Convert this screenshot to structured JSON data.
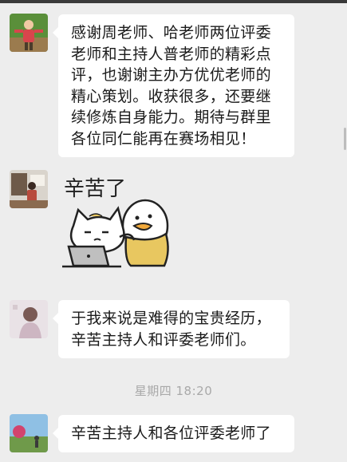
{
  "messages": [
    {
      "type": "text",
      "lines": [
        "感谢周老师、哈老师两位评委",
        "老师和主持人普老师的精彩点",
        "评，也谢谢主办方优优老师的",
        "精心策划。收获很多，还要继",
        "续修炼自身能力。期待与群里",
        "各位同仁能再在赛场相见！"
      ]
    },
    {
      "type": "sticker",
      "caption": "辛苦了"
    },
    {
      "type": "text",
      "lines": [
        "于我来说是难得的宝贵经历，",
        "辛苦主持人和评委老师们。"
      ]
    },
    {
      "type": "text",
      "lines": [
        "辛苦主持人和各位评委老师了"
      ]
    }
  ],
  "timestamp": "星期四 18:20",
  "colors": {
    "chat_background": "#ededed",
    "bubble": "#ffffff",
    "text": "#1b1b1b",
    "timestamp": "#a9a9a9",
    "sticker_duck": "#e8c760"
  }
}
